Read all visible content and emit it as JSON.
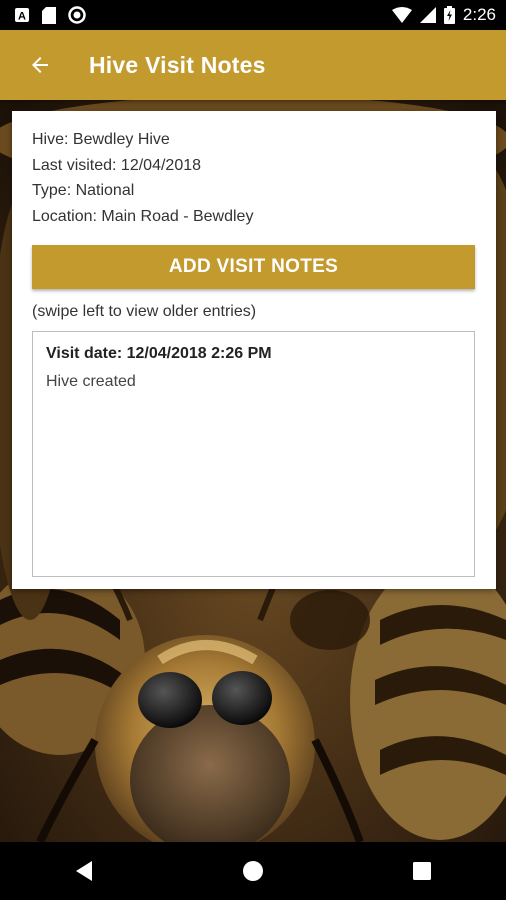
{
  "status_bar": {
    "time": "2:26",
    "left_icons": [
      "font-a-icon",
      "sd-card-icon",
      "sync-circle-icon"
    ],
    "right_icons": [
      "wifi-icon",
      "cell-signal-icon",
      "battery-charging-icon"
    ]
  },
  "app_bar": {
    "title": "Hive Visit Notes",
    "back_icon": "arrow-back-icon",
    "color": "#c39a2e"
  },
  "hive_info": {
    "name_line": "Hive: Bewdley Hive",
    "last_visited_line": "Last visited: 12/04/2018",
    "type_line": "Type: National",
    "location_line": "Location: Main Road - Bewdley"
  },
  "add_button": {
    "label": "ADD VISIT NOTES"
  },
  "swipe_hint": "(swipe left to view older entries)",
  "entry": {
    "date_line": "Visit date: 12/04/2018 2:26 PM",
    "text": "Hive created"
  },
  "nav_bar": {
    "icons": [
      "back-triangle-icon",
      "home-circle-icon",
      "recents-square-icon"
    ]
  }
}
